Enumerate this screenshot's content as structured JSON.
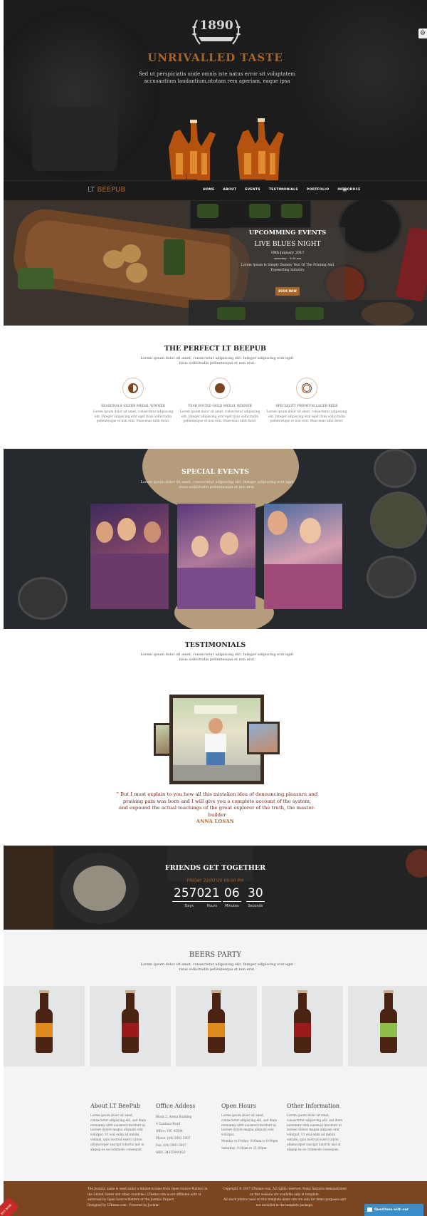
{
  "hero": {
    "year": "1890",
    "title": "UNRIVALLED TASTE",
    "subtitle": "Sed ut perspiciatis unde omnis iste natus error sit voluptatem accusantium laudantium,ntotam rem aperiam, eaque ipsa"
  },
  "nav": {
    "brand_prefix": "LT",
    "brand_highlight": "BEEPUB",
    "items": [
      "HOME",
      "ABOUT",
      "EVENTS",
      "TESTIMONIALS",
      "PORTFOLIO",
      "INTRODUCE"
    ]
  },
  "events": {
    "title": "UPCOMMING EVENTS",
    "name": "LIVE BLUES NIGHT",
    "date": "19th January 2017",
    "time": "saturday - 9:00 am",
    "text": "Lorem Ipsum Is Simply Dummy Text Of The Printing And Typesetting Industry.",
    "button": "BOOK NOW"
  },
  "perfect": {
    "title": "THE PERFECT LT BEEPUB",
    "subtitle": "Lorem ipsum dolor sit amet, consectetur adipiscing elit. Integer adipiscing erat eget risus sollicitudin pellentesque et non erat.",
    "features": [
      {
        "name": "SEASONALS SILVER MEDAL WINNER",
        "text": "Lorem ipsum dolor sit amet, consectetur adipiscing elit. Integer adipiscing erat eget risus sollicitudin pellentesque et non erat. Maecenas nibh dolor.",
        "icon": "half-circle-icon"
      },
      {
        "name": "YEAR ROUND GOLD MEDAL WINNER",
        "text": "Lorem ipsum dolor sit amet, consectetur adipiscing elit. Integer adipiscing erat eget risus sollicitudin pellentesque et non erat. Maecenas nibh dolor.",
        "icon": "bomb-icon"
      },
      {
        "name": "SPECIALITY PREMIUM LAGER BEER",
        "text": "Lorem ipsum dolor sit amet, consectetur adipiscing elit. Integer adipiscing erat eget risus sollicitudin pellentesque et non erat. Maecenas nibh dolor.",
        "icon": "target-icon"
      }
    ]
  },
  "special": {
    "title": "SPECIAL EVENTS",
    "subtitle": "Lorem ipsum dolor sit amet, consectetur adipiscing elit. Integer adipiscing erat eget risus sollicitudin pellentesque et non erat."
  },
  "testimonials": {
    "title": "TESTIMONIALS",
    "subtitle": "Lorem ipsum dolor sit amet, consectetur adipiscing elit. Integer adipiscing erat eget risus sollicitudin pellentesque et non erat.",
    "quote_line1": "\" But I must explain to you how all this mistaken idea of denouncing pleasure and",
    "quote_line2": "praising pain was born and I will give you a complete account of the system,",
    "quote_line3": "and expound the actual teachings of the great explorer of the truth, the master-builder",
    "author": "ANNA LOSAN"
  },
  "friends": {
    "title": "FRIENDS GET TOGETHER",
    "date": "FRIDAY 22/07/20 09:00 PM",
    "countdown": [
      {
        "value": "2570",
        "label": "Days"
      },
      {
        "value": "21",
        "label": "Hours"
      },
      {
        "value": "06",
        "label": "Minutes"
      },
      {
        "value": "30",
        "label": "Seconds"
      }
    ]
  },
  "beers": {
    "title": "BEERS PARTY",
    "subtitle": "Lorem ipsum dolor sit amet, consectetur adipiscing elit. Integer adipiscing erat eget risus sollicitudin pellentesque et non erat.",
    "label_colors": [
      "#e08a1e",
      "#9b1b1b",
      "#e08a1e",
      "#9b1b1b",
      "#8fbf4a"
    ]
  },
  "footer": {
    "about": {
      "title": "About LT BeePub",
      "text": "Lorem ipsum dolor sit amet, consectetur adipiscing elit, sed diam nonummy nibh euismod tincidunt ut laoreet dolore magna aliquam erat volutpat. Ut wisi enim ad minim veniam, quis nostrud exerci tation ullamcorper suscipit lobortis nisl ut aliquip ex ea commodo consequat."
    },
    "address": {
      "title": "Office Addess",
      "rows": [
        "Block 2, Arena Building",
        "4 Cardona Road",
        "Office: VIC 43504",
        "Phone: (04) 5903 5007",
        "Fax: (04) 5903 5007",
        "ABN: 34355944922"
      ]
    },
    "hours": {
      "title": "Open Hours",
      "text": "Lorem ipsum dolor sit amet, consectetur adipiscing elit, sed diam nonummy nibh euismod tincidunt ut laoreet dolore magna aliquam erat volutpat.",
      "rows": [
        "Monday to Friday: 9:00am to 9:00pm",
        "Saturday: 9:00am to 11:00pm"
      ]
    },
    "other": {
      "title": "Other Information",
      "text": "Lorem ipsum dolor sit amet, consectetur adipiscing elit, sed diam nonummy nibh euismod tincidunt ut laoreet dolore magna aliquam erat volutpat. Ut wisi enim ad minim veniam, quis nostrud exerci tation ullamcorper suscipit lobortis nisl ut aliquip ex ea commodo consequat."
    }
  },
  "bottom": {
    "left": "The Joomla! name is used under a limited license from Open Source Matters in the United States and other countries. LTheme.com is not affiliated with or endorsed by Open Source Matters or the Joomla! Project.",
    "designed": "Designed by LTheme.com - Powered by Joomla!",
    "right1": "Copyright © 2017 LTheme.com. All rights reserved. Many features demonstrated on this website are available only in template.",
    "right2": "All stock photos used on this template demo site are only for demo purposes and not included in the template package."
  },
  "chat": {
    "label": "Questions with our product?"
  },
  "corner": {
    "label": "BUY NOW"
  }
}
